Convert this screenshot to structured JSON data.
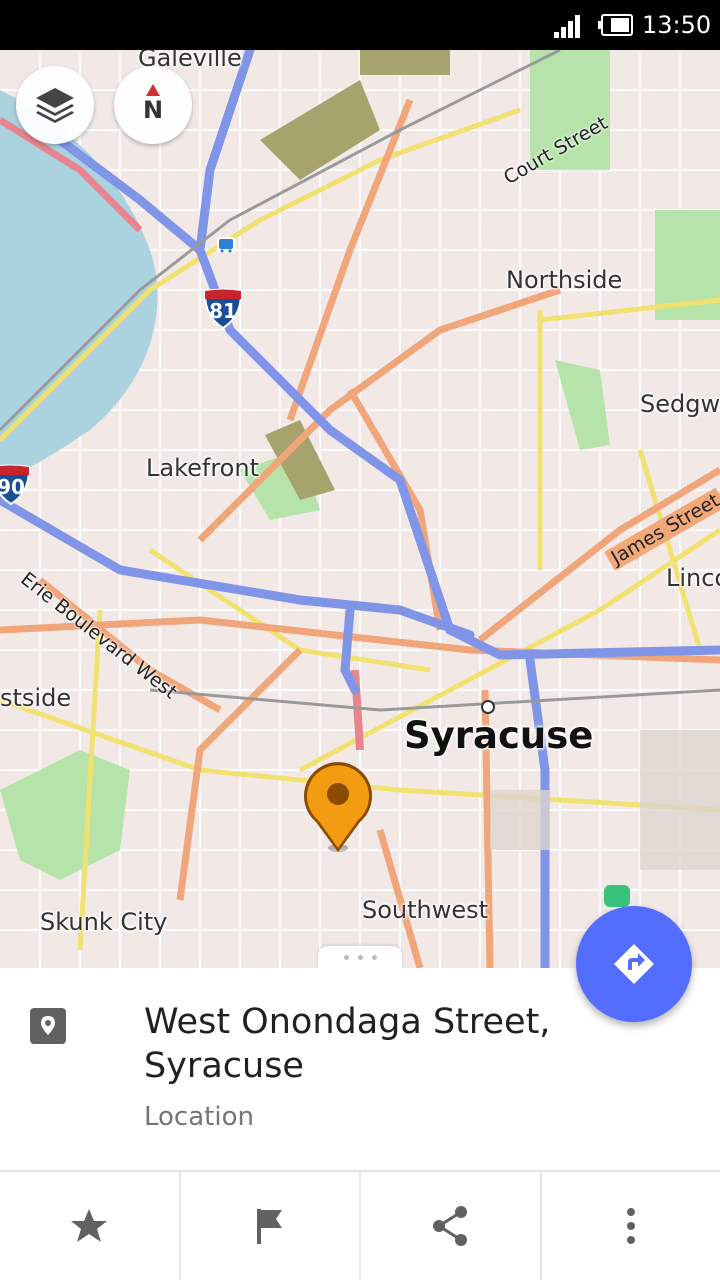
{
  "status_bar": {
    "time": "13:50",
    "icons": [
      "signal-icon",
      "battery-icon"
    ]
  },
  "map": {
    "controls": [
      "layers-icon",
      "compass-north-icon"
    ],
    "compass_label": "N",
    "areas": [
      {
        "name": "Galeville"
      },
      {
        "name": "Northside"
      },
      {
        "name": "Sedgw"
      },
      {
        "name": "Lakefront"
      },
      {
        "name": "Linco"
      },
      {
        "name": "stside"
      },
      {
        "name": "Skunk City"
      },
      {
        "name": "Southwest"
      }
    ],
    "city": "Syracuse",
    "streets": [
      "Court Street",
      "James Street",
      "Erie Boulevard West"
    ],
    "shields": [
      "81",
      "90"
    ],
    "colors": {
      "land": "#f2e9e6",
      "water": "#aad3df",
      "park": "#b5e3a9",
      "motorway": "#8095e8",
      "primary": "#f0a67a",
      "secondary": "#f1e170",
      "pin": "#f39c12"
    }
  },
  "place": {
    "title": "West Onondaga Street, Syracuse",
    "type": "Location",
    "icon": "place-pin-icon"
  },
  "actions": [
    {
      "name": "favorite",
      "icon": "star-icon"
    },
    {
      "name": "flag",
      "icon": "flag-icon"
    },
    {
      "name": "share",
      "icon": "share-icon"
    },
    {
      "name": "more",
      "icon": "more-vert-icon"
    }
  ],
  "fab": {
    "icon": "directions-icon",
    "color": "#536dfe"
  }
}
